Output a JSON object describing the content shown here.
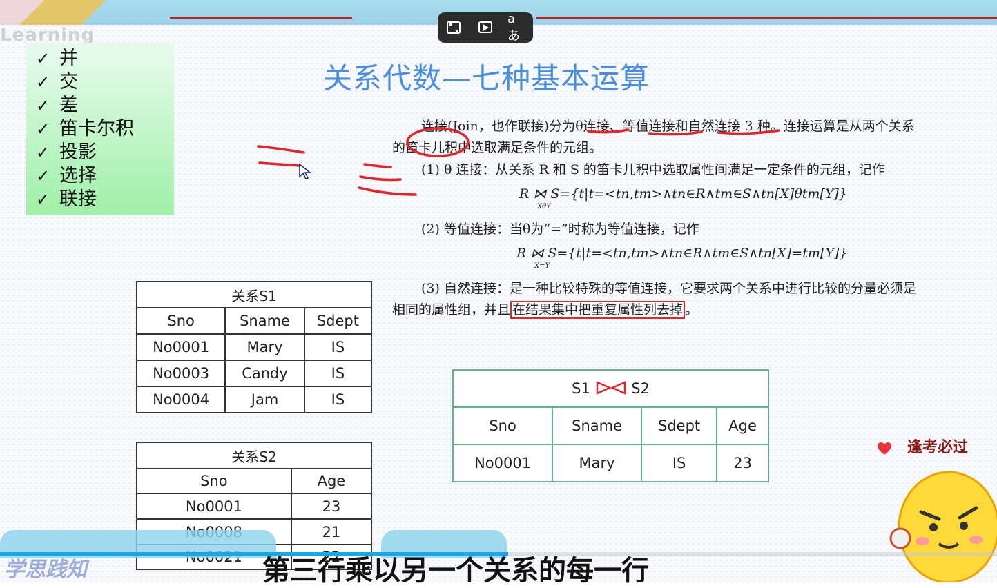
{
  "watermark": "Learning",
  "player": {
    "caption_label": "aあ"
  },
  "checklist": {
    "mark": "✓",
    "items": [
      "并",
      "交",
      "差",
      "笛卡尔积",
      "投影",
      "选择",
      "联接"
    ]
  },
  "slide": {
    "title": "关系代数—七种基本运算",
    "p1_line1": "连接(Join，也作联接)分为θ连接、等值连接和自然连接 3 种。连接运算是从两个关系",
    "p1_line2_a": "的",
    "p1_line2_circled": "笛卡儿积",
    "p1_line2_b": "中选取满足条件的元组。",
    "p2": "(1)  θ 连接：从关系 R 和 S 的笛卡儿积中选取属性间满足一定条件的元组，记作",
    "f1": "R ⋈ S={t|t=<tn,tm>∧tn∈R∧tm∈S∧tn[X]θtm[Y]}",
    "f1_sub": "XθY",
    "p3": "(2)  等值连接：当θ为“=”时称为等值连接，记作",
    "f2": "R ⋈ S={t|t=<tn,tm>∧tn∈R∧tm∈S∧tn[X]=tm[Y]}",
    "f2_sub": "X=Y",
    "p4": "(3)  自然连接：是一种比较特殊的等值连接，它要求两个关系中进行比较的分量必须是",
    "p5_a": "相同的属性组，并且",
    "p5_boxed": "在结果集中把重复属性列去掉",
    "p5_b": "。"
  },
  "table_s1": {
    "caption": "关系S1",
    "headers": [
      "Sno",
      "Sname",
      "Sdept"
    ],
    "rows": [
      [
        "No0001",
        "Mary",
        "IS"
      ],
      [
        "No0003",
        "Candy",
        "IS"
      ],
      [
        "No0004",
        "Jam",
        "IS"
      ]
    ]
  },
  "table_s2": {
    "caption": "关系S2",
    "headers": [
      "Sno",
      "Age"
    ],
    "rows": [
      [
        "No0001",
        "23"
      ],
      [
        "No0008",
        "21"
      ],
      [
        "No0021",
        "22"
      ]
    ]
  },
  "table_join": {
    "caption_left": "S1",
    "caption_right": "S2",
    "headers": [
      "Sno",
      "Sname",
      "Sdept",
      "Age"
    ],
    "rows": [
      [
        "No0001",
        "Mary",
        "IS",
        "23"
      ]
    ]
  },
  "subtitle": "第三行乘以另一个关系的每一行",
  "bottom_watermark": "学思践知",
  "sticker": "逢考必过",
  "progress": {
    "fraction": 0.51
  },
  "colors": {
    "title": "#4a8ee0",
    "annotation": "#e0262a",
    "progress": "#1ea5e0"
  }
}
